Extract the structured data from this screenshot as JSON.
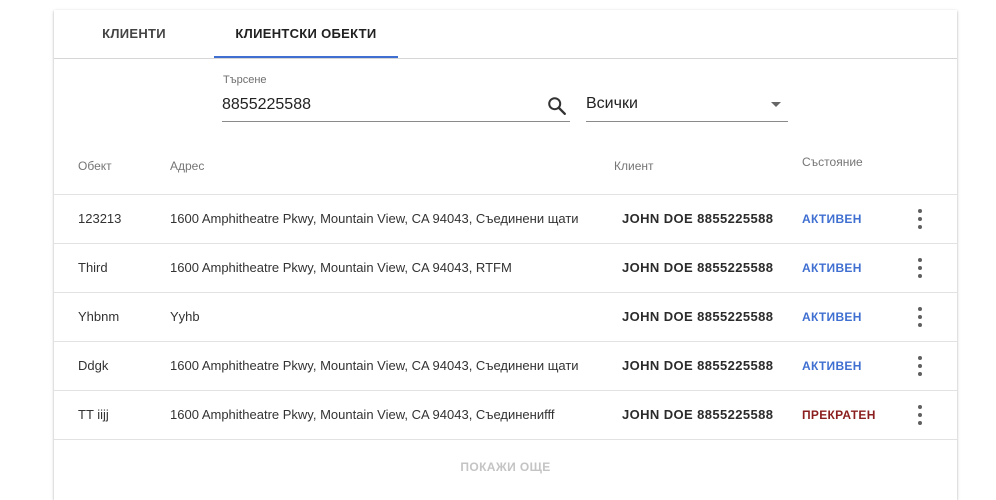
{
  "tabs": [
    {
      "label": "КЛИЕНТИ",
      "active": false
    },
    {
      "label": "КЛИЕНТСКИ ОБЕКТИ",
      "active": true
    }
  ],
  "colors": {
    "accent": "#3f6fd1",
    "status_active": "#3f6fd1",
    "status_stopped": "#8b1e1e"
  },
  "search": {
    "label": "Търсене",
    "value": "8855225588",
    "icon": "search-icon"
  },
  "filter": {
    "selected": "Всички",
    "icon": "dropdown-arrow-icon"
  },
  "table": {
    "headers": {
      "object": "Обект",
      "address": "Адрес",
      "client": "Клиент",
      "status": "Състояние"
    },
    "rows": [
      {
        "object": "123213",
        "address": "1600 Amphitheatre Pkwy, Mountain View, CA 94043, Съединени щати",
        "client": "JOHN DOE 8855225588",
        "status": "АКТИВЕН",
        "status_type": "active"
      },
      {
        "object": "Third",
        "address": "1600 Amphitheatre Pkwy, Mountain View, CA 94043, RTFM",
        "client": "JOHN DOE 8855225588",
        "status": "АКТИВЕН",
        "status_type": "active"
      },
      {
        "object": "Yhbnm",
        "address": "Yyhb",
        "client": "JOHN DOE 8855225588",
        "status": "АКТИВЕН",
        "status_type": "active"
      },
      {
        "object": "Ddgk",
        "address": "1600 Amphitheatre Pkwy, Mountain View, CA 94043, Съединени щати",
        "client": "JOHN DOE 8855225588",
        "status": "АКТИВЕН",
        "status_type": "active"
      },
      {
        "object": "TT iijj",
        "address": "1600 Amphitheatre Pkwy, Mountain View, CA 94043, Съединениfff",
        "client": "JOHN DOE 8855225588",
        "status": "ПРЕКРАТЕН",
        "status_type": "stopped"
      }
    ],
    "row_menu_icon": "more-vert-icon"
  },
  "load_more_label": "ПОКАЖИ ОЩЕ"
}
